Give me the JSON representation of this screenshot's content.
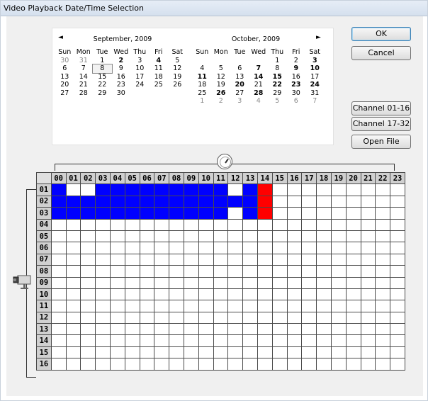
{
  "window": {
    "title": "Video Playback Date/Time Selection"
  },
  "calendar": {
    "prev_icon": "left-arrow-icon",
    "next_icon": "right-arrow-icon",
    "prev_glyph": "◄",
    "next_glyph": "►",
    "selected_day": "8",
    "months": [
      {
        "title": "September, 2009",
        "weekdays": [
          "Sun",
          "Mon",
          "Tue",
          "Wed",
          "Thu",
          "Fri",
          "Sat"
        ],
        "days": [
          {
            "d": "30",
            "s": "gray"
          },
          {
            "d": "31",
            "s": "gray"
          },
          {
            "d": "1",
            "s": ""
          },
          {
            "d": "2",
            "s": "bold"
          },
          {
            "d": "3",
            "s": ""
          },
          {
            "d": "4",
            "s": "bold"
          },
          {
            "d": "5",
            "s": ""
          },
          {
            "d": "6",
            "s": ""
          },
          {
            "d": "7",
            "s": ""
          },
          {
            "d": "8",
            "s": "sel"
          },
          {
            "d": "9",
            "s": ""
          },
          {
            "d": "10",
            "s": ""
          },
          {
            "d": "11",
            "s": ""
          },
          {
            "d": "12",
            "s": ""
          },
          {
            "d": "13",
            "s": ""
          },
          {
            "d": "14",
            "s": ""
          },
          {
            "d": "15",
            "s": ""
          },
          {
            "d": "16",
            "s": ""
          },
          {
            "d": "17",
            "s": ""
          },
          {
            "d": "18",
            "s": ""
          },
          {
            "d": "19",
            "s": ""
          },
          {
            "d": "20",
            "s": ""
          },
          {
            "d": "21",
            "s": ""
          },
          {
            "d": "22",
            "s": ""
          },
          {
            "d": "23",
            "s": ""
          },
          {
            "d": "24",
            "s": ""
          },
          {
            "d": "25",
            "s": ""
          },
          {
            "d": "26",
            "s": ""
          },
          {
            "d": "27",
            "s": ""
          },
          {
            "d": "28",
            "s": ""
          },
          {
            "d": "29",
            "s": ""
          },
          {
            "d": "30",
            "s": ""
          }
        ]
      },
      {
        "title": "October, 2009",
        "weekdays": [
          "Sun",
          "Mon",
          "Tue",
          "Wed",
          "Thu",
          "Fri",
          "Sat"
        ],
        "days": [
          {
            "d": "",
            "s": ""
          },
          {
            "d": "",
            "s": ""
          },
          {
            "d": "",
            "s": ""
          },
          {
            "d": "",
            "s": ""
          },
          {
            "d": "1",
            "s": ""
          },
          {
            "d": "2",
            "s": ""
          },
          {
            "d": "3",
            "s": "bold"
          },
          {
            "d": "4",
            "s": ""
          },
          {
            "d": "5",
            "s": ""
          },
          {
            "d": "6",
            "s": ""
          },
          {
            "d": "7",
            "s": "bold"
          },
          {
            "d": "8",
            "s": ""
          },
          {
            "d": "9",
            "s": "bold"
          },
          {
            "d": "10",
            "s": "bold"
          },
          {
            "d": "11",
            "s": "bold"
          },
          {
            "d": "12",
            "s": ""
          },
          {
            "d": "13",
            "s": ""
          },
          {
            "d": "14",
            "s": "bold"
          },
          {
            "d": "15",
            "s": "bold"
          },
          {
            "d": "16",
            "s": ""
          },
          {
            "d": "17",
            "s": ""
          },
          {
            "d": "18",
            "s": ""
          },
          {
            "d": "19",
            "s": ""
          },
          {
            "d": "20",
            "s": "bold"
          },
          {
            "d": "21",
            "s": ""
          },
          {
            "d": "22",
            "s": "bold"
          },
          {
            "d": "23",
            "s": "bold"
          },
          {
            "d": "24",
            "s": "bold"
          },
          {
            "d": "25",
            "s": ""
          },
          {
            "d": "26",
            "s": "bold"
          },
          {
            "d": "27",
            "s": ""
          },
          {
            "d": "28",
            "s": "bold"
          },
          {
            "d": "29",
            "s": ""
          },
          {
            "d": "30",
            "s": ""
          },
          {
            "d": "31",
            "s": ""
          },
          {
            "d": "1",
            "s": "gray"
          },
          {
            "d": "2",
            "s": "gray"
          },
          {
            "d": "3",
            "s": "gray"
          },
          {
            "d": "4",
            "s": "gray"
          },
          {
            "d": "5",
            "s": "gray"
          },
          {
            "d": "6",
            "s": "gray"
          },
          {
            "d": "7",
            "s": "gray"
          }
        ]
      }
    ]
  },
  "buttons": {
    "ok": "OK",
    "cancel": "Cancel",
    "channel_1_16": "Channel 01-16",
    "channel_17_32": "Channel 17-32",
    "open_file": "Open File"
  },
  "schedule": {
    "clock_icon": "clock-icon",
    "camera_icon": "camera-icon",
    "hours": [
      "00",
      "01",
      "02",
      "03",
      "04",
      "05",
      "06",
      "07",
      "08",
      "09",
      "10",
      "11",
      "12",
      "13",
      "14",
      "15",
      "16",
      "17",
      "18",
      "19",
      "20",
      "21",
      "22",
      "23"
    ],
    "channels": [
      "01",
      "02",
      "03",
      "04",
      "05",
      "06",
      "07",
      "08",
      "09",
      "10",
      "11",
      "12",
      "13",
      "14",
      "15",
      "16"
    ],
    "colors": {
      "recorded": "#0000ff",
      "event": "#ff0000",
      "empty": "#ffffff"
    },
    "cells": [
      [
        "R",
        "",
        "",
        "R",
        "R",
        "R",
        "R",
        "R",
        "R",
        "R",
        "R",
        "R",
        "",
        "R",
        "E",
        "",
        "",
        "",
        "",
        "",
        "",
        "",
        "",
        ""
      ],
      [
        "R",
        "R",
        "R",
        "R",
        "R",
        "R",
        "R",
        "R",
        "R",
        "R",
        "R",
        "R",
        "R",
        "R",
        "E",
        "",
        "",
        "",
        "",
        "",
        "",
        "",
        "",
        ""
      ],
      [
        "R",
        "R",
        "R",
        "R",
        "R",
        "R",
        "R",
        "R",
        "R",
        "R",
        "R",
        "R",
        "",
        "R",
        "E",
        "",
        "",
        "",
        "",
        "",
        "",
        "",
        "",
        ""
      ],
      [
        "",
        "",
        "",
        "",
        "",
        "",
        "",
        "",
        "",
        "",
        "",
        "",
        "",
        "",
        "",
        "",
        "",
        "",
        "",
        "",
        "",
        "",
        "",
        ""
      ],
      [
        "",
        "",
        "",
        "",
        "",
        "",
        "",
        "",
        "",
        "",
        "",
        "",
        "",
        "",
        "",
        "",
        "",
        "",
        "",
        "",
        "",
        "",
        "",
        ""
      ],
      [
        "",
        "",
        "",
        "",
        "",
        "",
        "",
        "",
        "",
        "",
        "",
        "",
        "",
        "",
        "",
        "",
        "",
        "",
        "",
        "",
        "",
        "",
        "",
        ""
      ],
      [
        "",
        "",
        "",
        "",
        "",
        "",
        "",
        "",
        "",
        "",
        "",
        "",
        "",
        "",
        "",
        "",
        "",
        "",
        "",
        "",
        "",
        "",
        "",
        ""
      ],
      [
        "",
        "",
        "",
        "",
        "",
        "",
        "",
        "",
        "",
        "",
        "",
        "",
        "",
        "",
        "",
        "",
        "",
        "",
        "",
        "",
        "",
        "",
        "",
        ""
      ],
      [
        "",
        "",
        "",
        "",
        "",
        "",
        "",
        "",
        "",
        "",
        "",
        "",
        "",
        "",
        "",
        "",
        "",
        "",
        "",
        "",
        "",
        "",
        "",
        ""
      ],
      [
        "",
        "",
        "",
        "",
        "",
        "",
        "",
        "",
        "",
        "",
        "",
        "",
        "",
        "",
        "",
        "",
        "",
        "",
        "",
        "",
        "",
        "",
        "",
        ""
      ],
      [
        "",
        "",
        "",
        "",
        "",
        "",
        "",
        "",
        "",
        "",
        "",
        "",
        "",
        "",
        "",
        "",
        "",
        "",
        "",
        "",
        "",
        "",
        "",
        ""
      ],
      [
        "",
        "",
        "",
        "",
        "",
        "",
        "",
        "",
        "",
        "",
        "",
        "",
        "",
        "",
        "",
        "",
        "",
        "",
        "",
        "",
        "",
        "",
        "",
        ""
      ],
      [
        "",
        "",
        "",
        "",
        "",
        "",
        "",
        "",
        "",
        "",
        "",
        "",
        "",
        "",
        "",
        "",
        "",
        "",
        "",
        "",
        "",
        "",
        "",
        ""
      ],
      [
        "",
        "",
        "",
        "",
        "",
        "",
        "",
        "",
        "",
        "",
        "",
        "",
        "",
        "",
        "",
        "",
        "",
        "",
        "",
        "",
        "",
        "",
        "",
        ""
      ],
      [
        "",
        "",
        "",
        "",
        "",
        "",
        "",
        "",
        "",
        "",
        "",
        "",
        "",
        "",
        "",
        "",
        "",
        "",
        "",
        "",
        "",
        "",
        "",
        ""
      ],
      [
        "",
        "",
        "",
        "",
        "",
        "",
        "",
        "",
        "",
        "",
        "",
        "",
        "",
        "",
        "",
        "",
        "",
        "",
        "",
        "",
        "",
        "",
        "",
        ""
      ]
    ]
  }
}
